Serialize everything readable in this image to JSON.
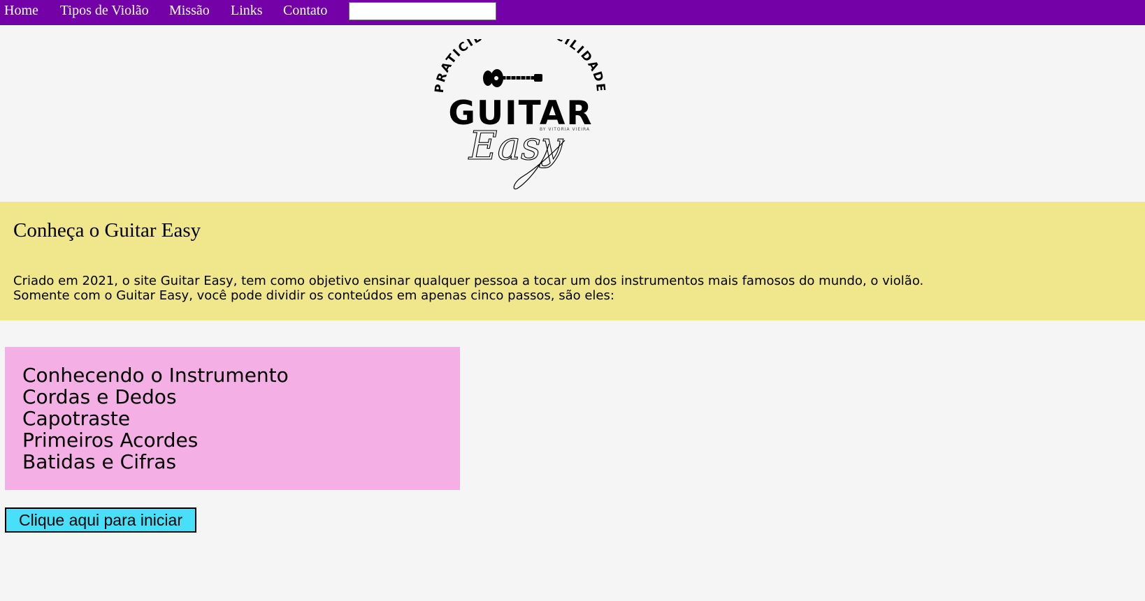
{
  "nav": {
    "links": [
      "Home",
      "Tipos de Violão",
      "Missão",
      "Links",
      "Contato"
    ],
    "search_value": ""
  },
  "logo": {
    "arc_text": "PRATICIDADE E FACILIDADE",
    "brand": "GUITAR",
    "byline": "BY VITORIA VIEIRA",
    "script": "Easy"
  },
  "intro": {
    "title": "Conheça o Guitar Easy",
    "line1": "Criado em 2021, o site Guitar Easy, tem como objetivo ensinar qualquer pessoa a tocar um dos instrumentos mais famosos do mundo, o violão.",
    "line2": "Somente com o Guitar Easy, você pode dividir os conteúdos em apenas cinco passos, são eles:"
  },
  "steps": [
    "Conhecendo o Instrumento",
    "Cordas e Dedos",
    "Capotraste",
    "Primeiros Acordes",
    "Batidas e Cifras"
  ],
  "start_button": "Clique aqui para iniciar",
  "colors": {
    "nav_bg": "#7400a8",
    "intro_bg": "#f0e68c",
    "steps_bg": "#f4b0e5",
    "button_bg": "#48e0f8",
    "page_bg": "#f5f5f5"
  }
}
